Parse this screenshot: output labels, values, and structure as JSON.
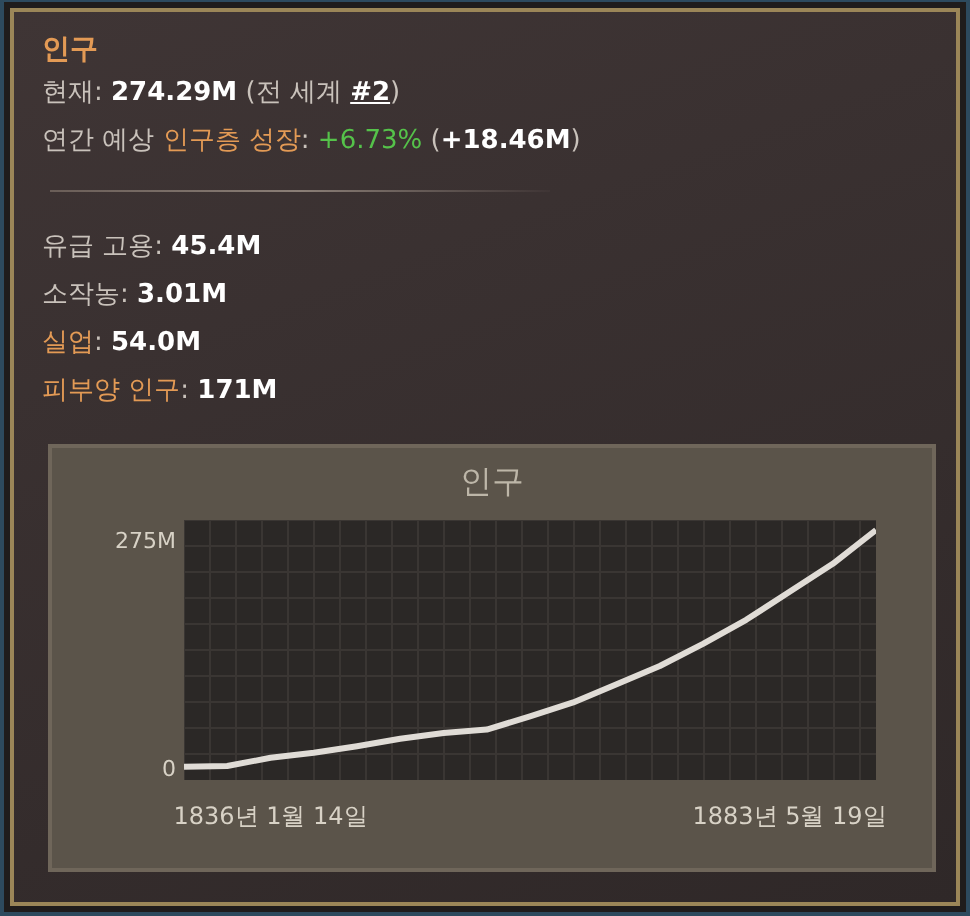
{
  "title": "인구",
  "summary": [
    {
      "segments": [
        {
          "text": "현재: ",
          "kind": "label"
        },
        {
          "text": "274.29M",
          "kind": "value"
        },
        {
          "text": " (전 세계 ",
          "kind": "label"
        },
        {
          "text": "#2",
          "kind": "link"
        },
        {
          "text": ")",
          "kind": "label"
        }
      ]
    },
    {
      "segments": [
        {
          "text": "연간 예상 ",
          "kind": "label"
        },
        {
          "text": "인구층 성장",
          "kind": "highlight"
        },
        {
          "text": ": ",
          "kind": "label"
        },
        {
          "text": "+6.73%",
          "kind": "positive"
        },
        {
          "text": "  (",
          "kind": "label"
        },
        {
          "text": "+18.46M",
          "kind": "value"
        },
        {
          "text": ")",
          "kind": "label"
        }
      ]
    }
  ],
  "stats": [
    {
      "segments": [
        {
          "text": "유급 고용",
          "kind": "label"
        },
        {
          "text": ": ",
          "kind": "label"
        },
        {
          "text": "45.4M",
          "kind": "value"
        }
      ]
    },
    {
      "segments": [
        {
          "text": "소작농",
          "kind": "label"
        },
        {
          "text": ": ",
          "kind": "label"
        },
        {
          "text": "3.01M",
          "kind": "value"
        }
      ]
    },
    {
      "segments": [
        {
          "text": "실업",
          "kind": "highlight"
        },
        {
          "text": ": ",
          "kind": "label"
        },
        {
          "text": "54.0M",
          "kind": "value"
        }
      ]
    },
    {
      "segments": [
        {
          "text": "피부양 인구",
          "kind": "highlight"
        },
        {
          "text": ": ",
          "kind": "label"
        },
        {
          "text": "171M",
          "kind": "value"
        }
      ]
    }
  ],
  "chart": {
    "chart_data": {
      "type": "line",
      "title": "인구",
      "categories": [
        null,
        null,
        "1836년 1월 14일",
        null,
        null,
        null,
        null,
        null,
        null,
        null,
        null,
        null,
        null,
        null,
        "1883년 5월 19일",
        null,
        null
      ],
      "series": [
        {
          "color": "#e0dcd6",
          "values": [
            1,
            2,
            12,
            18,
            26,
            35,
            42,
            46,
            62,
            79,
            101,
            123,
            150,
            179,
            213,
            247,
            288
          ]
        }
      ],
      "grid": true,
      "ylim": [
        -15,
        300
      ],
      "yticks": [
        {
          "value": 0,
          "label": "0"
        },
        {
          "value": 275,
          "label": "275M"
        }
      ]
    }
  }
}
